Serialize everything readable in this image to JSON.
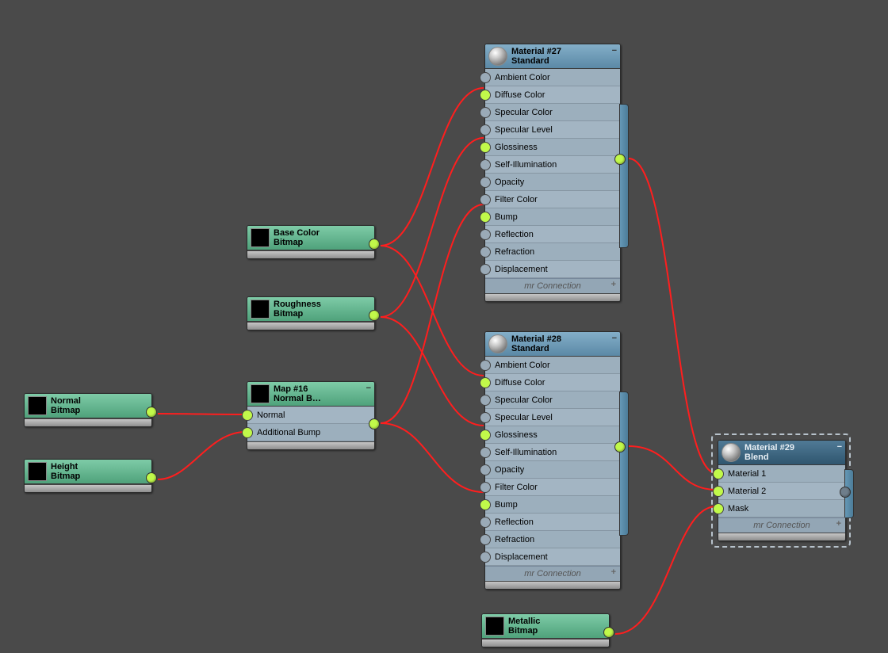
{
  "bitmap_nodes": {
    "base_color": {
      "title": "Base Color",
      "sub": "Bitmap"
    },
    "roughness": {
      "title": "Roughness",
      "sub": "Bitmap"
    },
    "normal": {
      "title": "Normal",
      "sub": "Bitmap"
    },
    "height": {
      "title": "Height",
      "sub": "Bitmap"
    },
    "metallic": {
      "title": "Metallic",
      "sub": "Bitmap"
    }
  },
  "normal_bump_node": {
    "title": "Map #16",
    "sub": "Normal B…",
    "slots": [
      "Normal",
      "Additional Bump"
    ]
  },
  "material_slots": [
    "Ambient Color",
    "Diffuse Color",
    "Specular Color",
    "Specular Level",
    "Glossiness",
    "Self-Illumination",
    "Opacity",
    "Filter Color",
    "Bump",
    "Reflection",
    "Refraction",
    "Displacement"
  ],
  "material27": {
    "title": "Material #27",
    "sub": "Standard",
    "footer": "mr Connection",
    "active": [
      1,
      4,
      8
    ]
  },
  "material28": {
    "title": "Material #28",
    "sub": "Standard",
    "footer": "mr Connection",
    "active": [
      1,
      4,
      8
    ]
  },
  "blend": {
    "title": "Material #29",
    "sub": "Blend",
    "slots": [
      "Material 1",
      "Material 2",
      "Mask"
    ],
    "footer": "mr Connection",
    "active": [
      0,
      1,
      2
    ]
  }
}
